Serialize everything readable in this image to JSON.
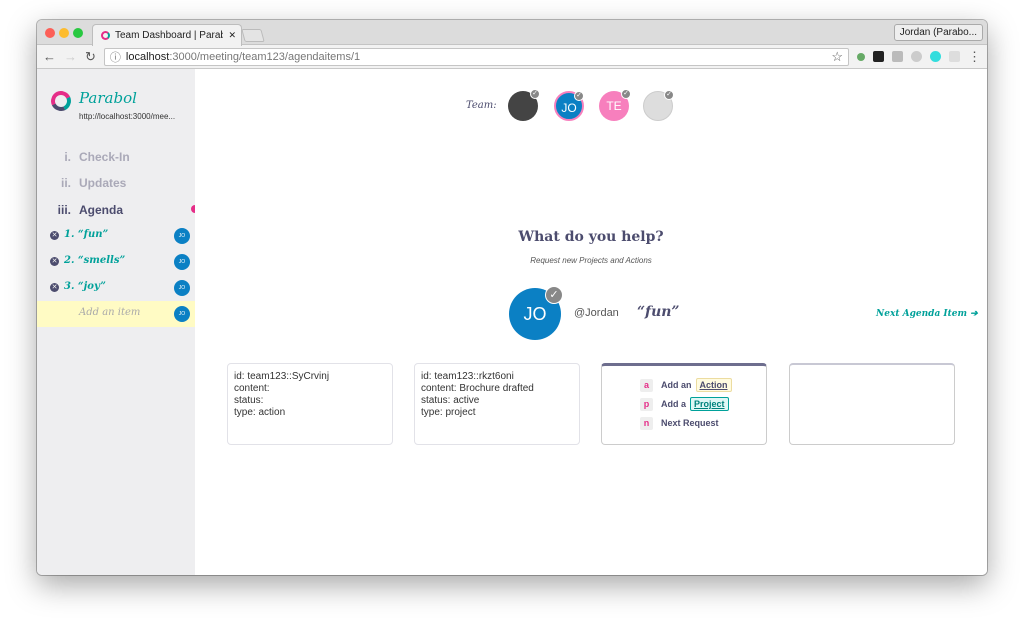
{
  "browser": {
    "tab_title": "Team Dashboard | Parabol, Inc",
    "tab_close": "✕",
    "profile": "Jordan (Parabo...",
    "url_host": "localhost",
    "url_rest": ":3000/meeting/team123/agendaitems/1",
    "back": "←",
    "forward": "→",
    "reload": "↻",
    "info": "ⓘ",
    "star": "☆",
    "menu": "⋮"
  },
  "sidebar": {
    "brand": "Parabol",
    "url": "http://localhost:3000/mee...",
    "nav": [
      {
        "num": "i.",
        "label": "Check-In"
      },
      {
        "num": "ii.",
        "label": "Updates"
      },
      {
        "num": "iii.",
        "label": "Agenda"
      }
    ],
    "agenda": [
      {
        "label": "1. “fun”",
        "avatar": "JO"
      },
      {
        "label": "2. “smells”",
        "avatar": "JO"
      },
      {
        "label": "3. “joy”",
        "avatar": "JO"
      }
    ],
    "add_placeholder": "Add an item",
    "add_avatar": "JO",
    "accent": "#e52d88",
    "teal": "#00a19a"
  },
  "team": {
    "label": "Team:",
    "members": [
      {
        "initials": "",
        "type": "photo"
      },
      {
        "initials": "JO",
        "color": "#0b80c4"
      },
      {
        "initials": "TE",
        "color": "#f77fbd"
      },
      {
        "initials": "",
        "type": "photo"
      }
    ]
  },
  "main": {
    "heading": "What do you help?",
    "subheading": "Request new Projects and Actions",
    "owner_initials": "JO",
    "owner_handle": "@Jordan",
    "item": "“fun”",
    "next": "Next Agenda Item",
    "cards": [
      [
        "id: team123::SyCrvinj",
        "content:",
        "status:",
        "type: action"
      ],
      [
        "id: team123::rkzt6oni",
        "content: Brochure drafted",
        "status: active",
        "type: project"
      ]
    ],
    "shortcuts": [
      {
        "key": "a",
        "text": "Add an",
        "pill": "Action"
      },
      {
        "key": "p",
        "text": "Add a",
        "pill": "Project"
      },
      {
        "key": "n",
        "text": "Next Request",
        "pill": ""
      }
    ]
  }
}
